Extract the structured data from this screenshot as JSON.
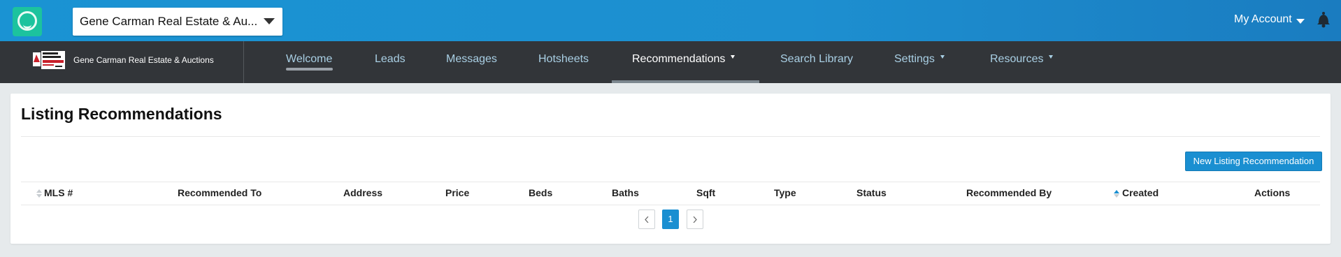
{
  "header": {
    "account_select_value": "Gene Carman Real Estate & Au...",
    "my_account_label": "My Account"
  },
  "navbar": {
    "brand_name": "Gene Carman Real Estate & Auctions",
    "items": [
      {
        "label": "Welcome"
      },
      {
        "label": "Leads"
      },
      {
        "label": "Messages"
      },
      {
        "label": "Hotsheets"
      },
      {
        "label": "Recommendations"
      },
      {
        "label": "Search Library"
      },
      {
        "label": "Settings"
      },
      {
        "label": "Resources"
      }
    ]
  },
  "main": {
    "title": "Listing Recommendations",
    "new_button_label": "New Listing Recommendation",
    "table": {
      "columns": [
        "MLS #",
        "Recommended To",
        "Address",
        "Price",
        "Beds",
        "Baths",
        "Sqft",
        "Type",
        "Status",
        "Recommended By",
        "Created",
        "Actions"
      ],
      "rows": []
    },
    "pagination": {
      "current_page": "1"
    }
  },
  "colors": {
    "topbar": "#1a93d3",
    "navbar": "#323539",
    "accent": "#1a8fd1",
    "app_logo": "#1cc39e"
  },
  "icons": {
    "app_logo": "smile-logo-icon",
    "account_caret": "chevron-down-icon",
    "notifications": "bell-icon",
    "sort": "sort-icon",
    "prev": "chevron-left-icon",
    "next": "chevron-right-icon"
  }
}
